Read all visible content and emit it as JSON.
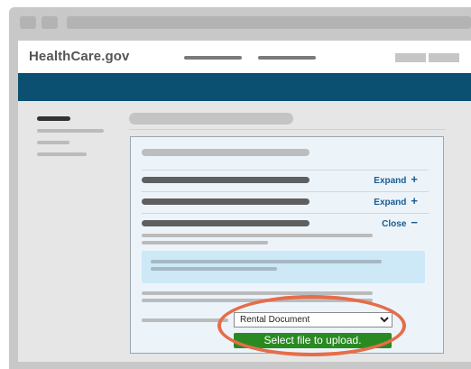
{
  "header": {
    "logo": "HealthCare.gov"
  },
  "accordion": {
    "items": [
      {
        "action_label": "Expand",
        "symbol": "+"
      },
      {
        "action_label": "Expand",
        "symbol": "+"
      },
      {
        "action_label": "Close",
        "symbol": "−"
      }
    ]
  },
  "upload": {
    "document_type": "Rental Document",
    "button_label": "Select file to upload."
  },
  "colors": {
    "nav_band": "#0b4f71",
    "upload_button": "#2a8a22",
    "highlight_ring": "#e56d4a",
    "info_box": "#cde9f8"
  }
}
